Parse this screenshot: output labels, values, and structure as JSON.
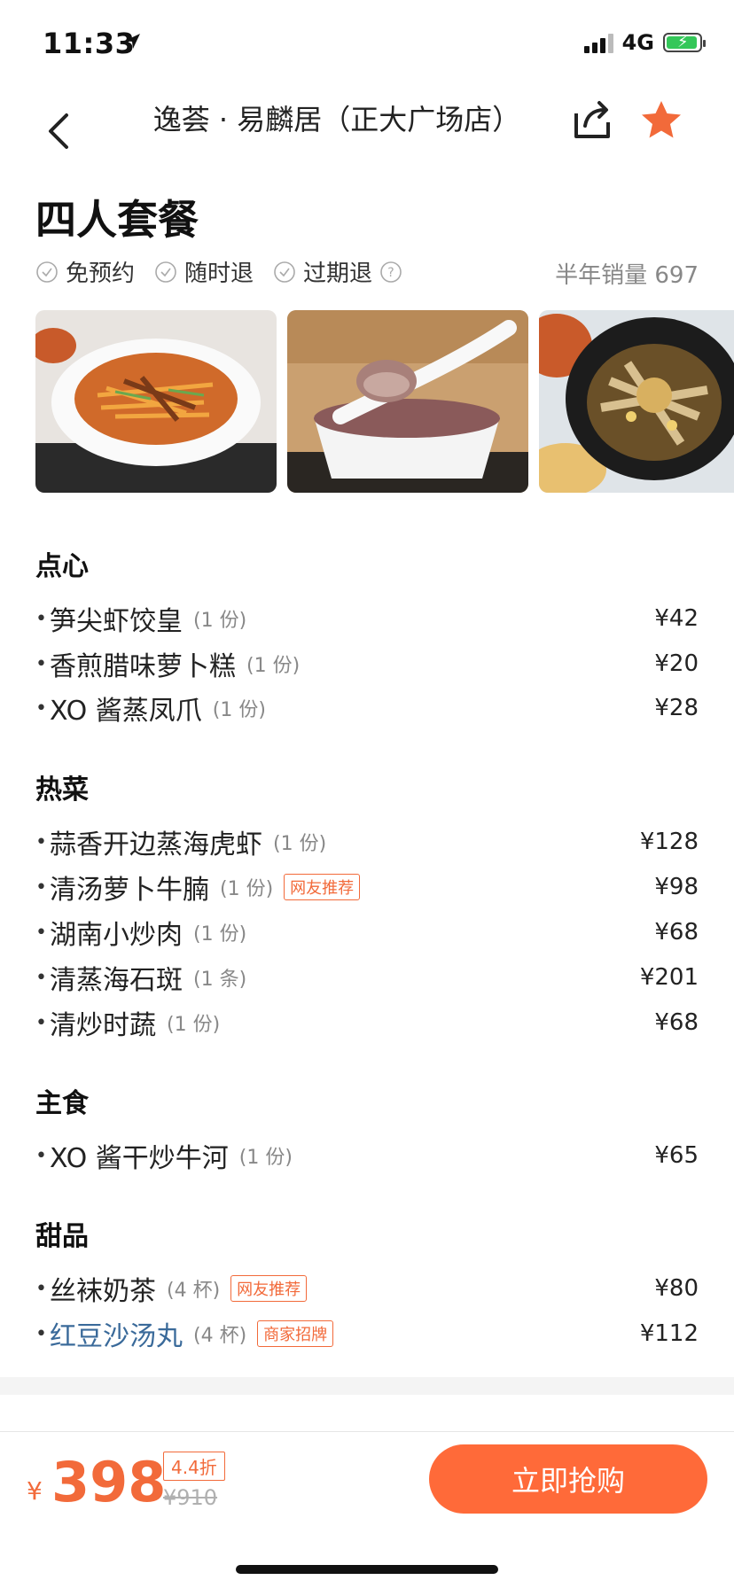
{
  "status_bar": {
    "time": "11:33",
    "network": "4G"
  },
  "nav": {
    "title": "逸荟 · 易麟居（正大广场店）",
    "star_color": "#f26a3a"
  },
  "package": {
    "title": "四人套餐",
    "tags": [
      {
        "label": "免预约",
        "icon": "check-circle-icon"
      },
      {
        "label": "随时退",
        "icon": "check-circle-icon"
      },
      {
        "label": "过期退",
        "icon": "check-circle-icon"
      }
    ],
    "sales": "半年销量 697"
  },
  "sections": [
    {
      "title": "点心",
      "items": [
        {
          "name": "笋尖虾饺皇",
          "qty": "(1 份)",
          "price": "¥42"
        },
        {
          "name": "香煎腊味萝卜糕",
          "qty": "(1 份)",
          "price": "¥20"
        },
        {
          "name": "XO 酱蒸凤爪",
          "qty": "(1 份)",
          "price": "¥28"
        }
      ]
    },
    {
      "title": "热菜",
      "items": [
        {
          "name": "蒜香开边蒸海虎虾",
          "qty": "(1 份)",
          "price": "¥128"
        },
        {
          "name": "清汤萝卜牛腩",
          "qty": "(1 份)",
          "badge": "网友推荐",
          "price": "¥98"
        },
        {
          "name": "湖南小炒肉",
          "qty": "(1 份)",
          "price": "¥68"
        },
        {
          "name": "清蒸海石斑",
          "qty": "(1 条)",
          "price": "¥201"
        },
        {
          "name": "清炒时蔬",
          "qty": "(1 份)",
          "price": "¥68"
        }
      ]
    },
    {
      "title": "主食",
      "items": [
        {
          "name": "XO 酱干炒牛河",
          "qty": "(1 份)",
          "price": "¥65"
        }
      ]
    },
    {
      "title": "甜品",
      "items": [
        {
          "name": "丝袜奶茶",
          "qty": "(4 杯)",
          "badge": "网友推荐",
          "price": "¥80"
        },
        {
          "name": "红豆沙汤丸",
          "qty": "(4 杯)",
          "badge": "商家招牌",
          "price": "¥112"
        }
      ]
    }
  ],
  "bottom_bar": {
    "currency": "¥",
    "price": "398",
    "discount": "4.4折",
    "original_price": "¥910",
    "buy_label": "立即抢购",
    "accent_color": "#ff6a39"
  }
}
